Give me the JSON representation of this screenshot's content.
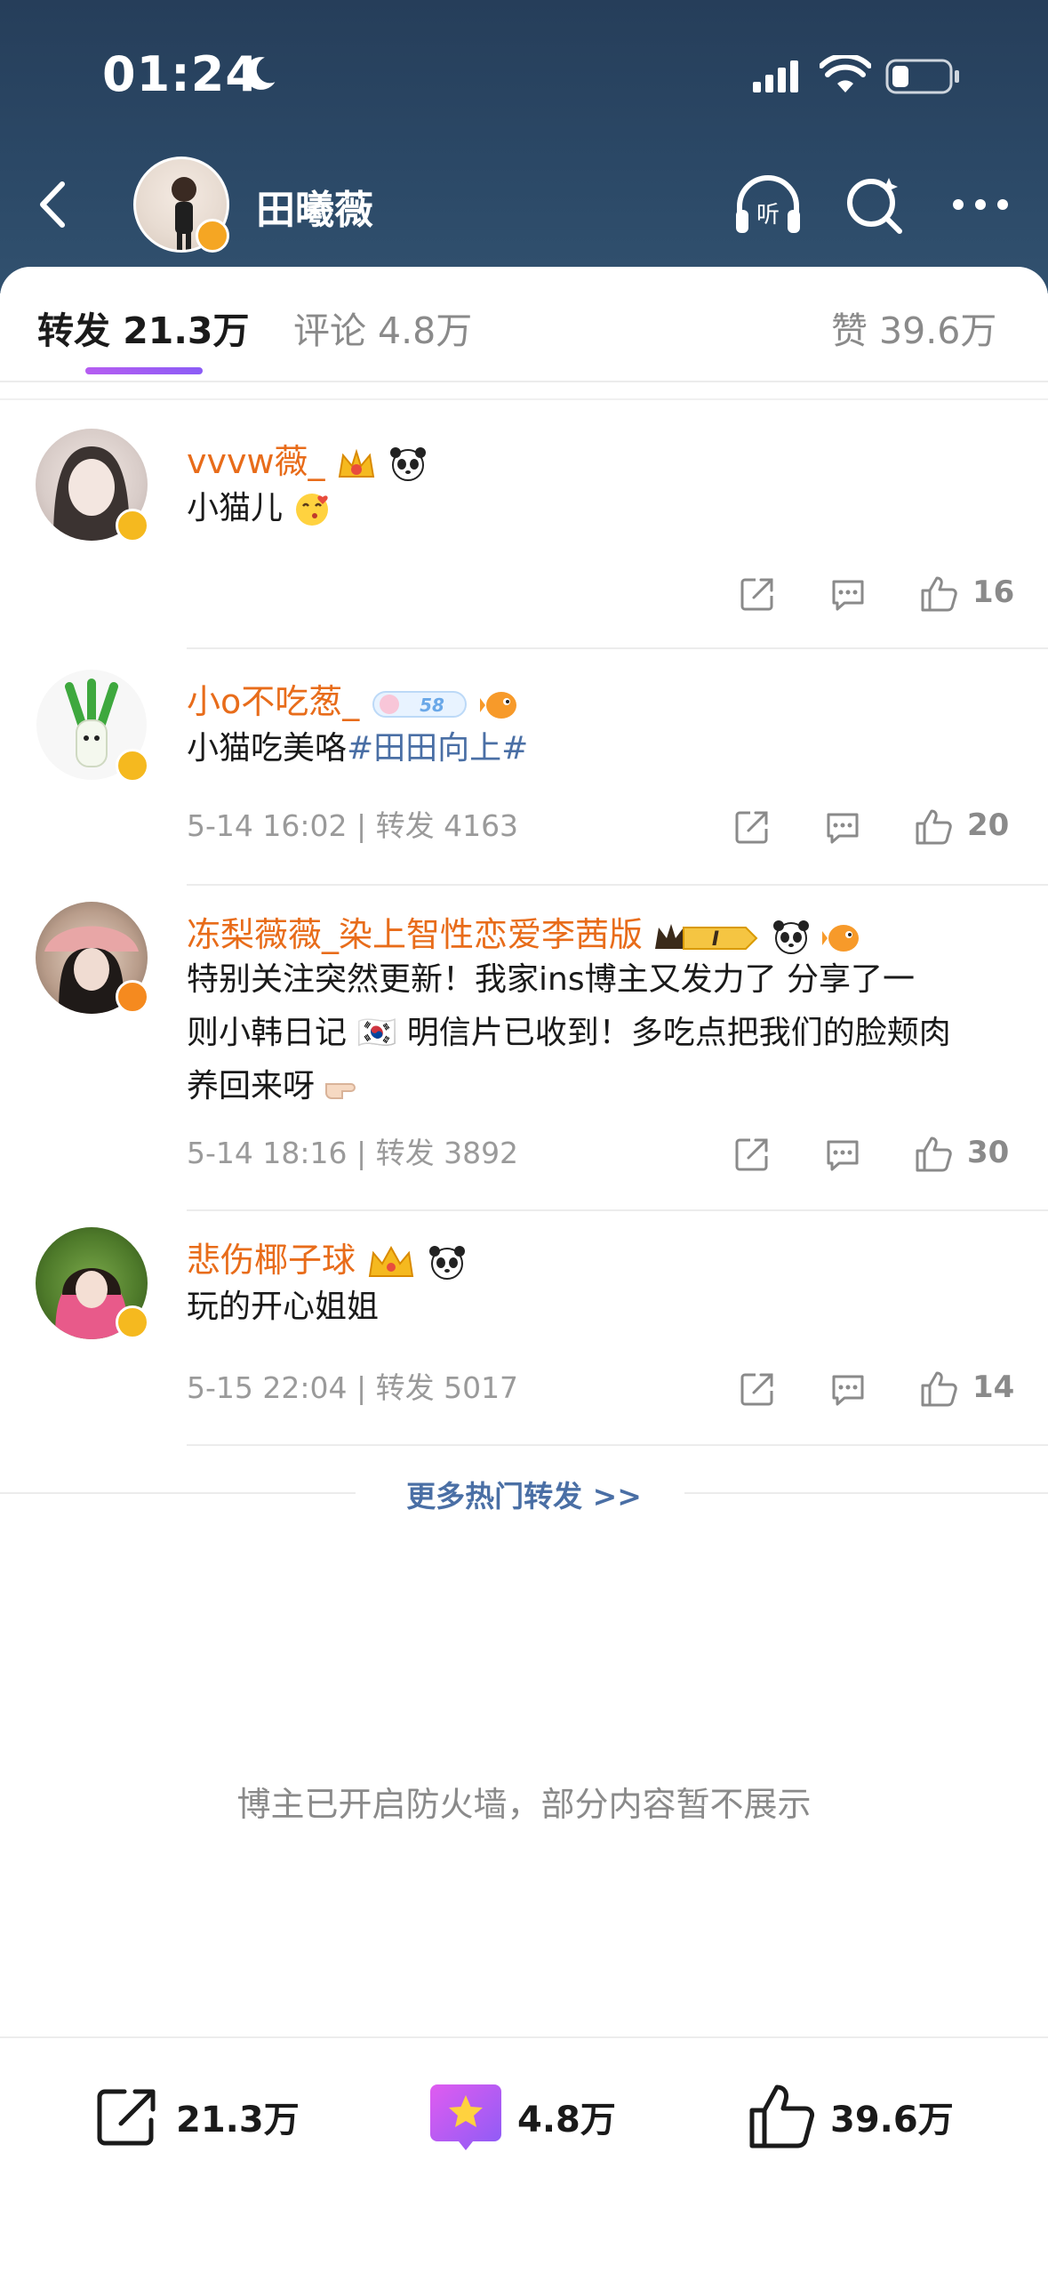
{
  "status_bar": {
    "time": "01:24"
  },
  "nav": {
    "title": "田曦薇"
  },
  "tabs": [
    {
      "label": "转发",
      "count": "21.3万"
    },
    {
      "label": "评论",
      "count": "4.8万"
    },
    {
      "label": "赞",
      "count": "39.6万"
    }
  ],
  "comments": [
    {
      "name": "vvvw薇_",
      "text": "小猫儿",
      "meta": "",
      "like_count": "16"
    },
    {
      "name": "小o不吃葱_",
      "text": "小猫吃美咯",
      "hashtag": "#田田向上#",
      "badge_label": "58",
      "meta": "5-14 16:02 | 转发 4163",
      "like_count": "20"
    },
    {
      "name": "冻梨薇薇_染上智性恋爱李茜版",
      "badge_label": "I",
      "text_line1": "特别关注突然更新！我家ins博主又发力了 分享了一",
      "text_line2": "则小韩日记 🇰🇷 明信片已收到！多吃点把我们的脸颊肉",
      "text_line3": "养回来呀",
      "meta": "5-14 18:16 | 转发 3892",
      "like_count": "30"
    },
    {
      "name": "悲伤椰子球",
      "text": "玩的开心姐姐",
      "meta": "5-15 22:04 | 转发 5017",
      "like_count": "14"
    }
  ],
  "more_hot": "更多热门转发 >>",
  "firewall_note": "博主已开启防火墙，部分内容暂不展示",
  "bottom_bar": {
    "repost_count": "21.3万",
    "comment_count": "4.8万",
    "like_count": "39.6万"
  },
  "colors": {
    "header_bg": "#2b4866",
    "name_orange": "#e86c1a",
    "hashtag_blue": "#4a6fa5",
    "tab_underline": "#a35cf0"
  }
}
